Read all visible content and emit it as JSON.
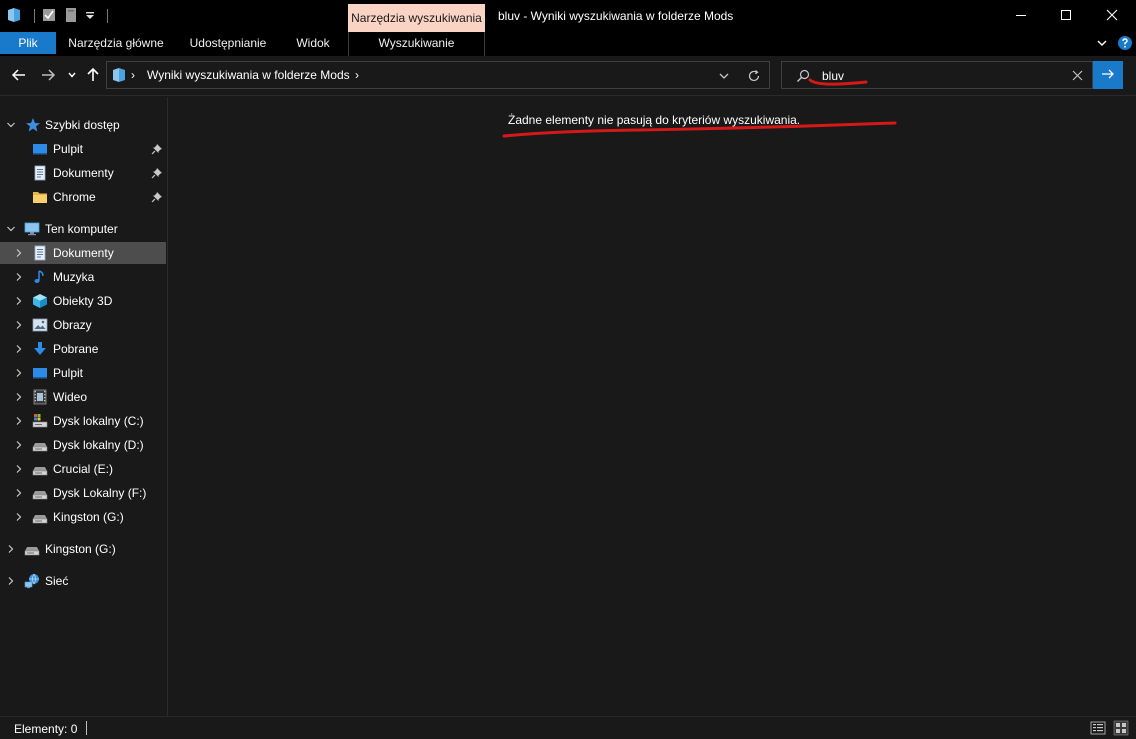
{
  "window": {
    "title": "bluv - Wyniki wyszukiwania w folderze Mods",
    "context_tab": "Narzędzia wyszukiwania"
  },
  "ribbon": {
    "tabs": [
      {
        "label": "Plik"
      },
      {
        "label": "Narzędzia główne"
      },
      {
        "label": "Udostępnianie"
      },
      {
        "label": "Widok"
      },
      {
        "label": "Wyszukiwanie"
      }
    ]
  },
  "address": {
    "path": "Wyniki wyszukiwania w folderze Mods",
    "separator": "›"
  },
  "search": {
    "value": "bluv"
  },
  "sidebar": {
    "quick_access": {
      "label": "Szybki dostęp",
      "items": [
        {
          "label": "Pulpit",
          "icon": "desktop-icon",
          "pinned": true
        },
        {
          "label": "Dokumenty",
          "icon": "documents-icon",
          "pinned": true
        },
        {
          "label": "Chrome",
          "icon": "folder-icon",
          "pinned": true
        }
      ]
    },
    "this_pc": {
      "label": "Ten komputer",
      "items": [
        {
          "label": "Dokumenty",
          "icon": "documents-icon",
          "selected": true
        },
        {
          "label": "Muzyka",
          "icon": "music-icon"
        },
        {
          "label": "Obiekty 3D",
          "icon": "cube-3d-icon"
        },
        {
          "label": "Obrazy",
          "icon": "pictures-icon"
        },
        {
          "label": "Pobrane",
          "icon": "download-icon"
        },
        {
          "label": "Pulpit",
          "icon": "desktop-icon"
        },
        {
          "label": "Wideo",
          "icon": "video-icon"
        },
        {
          "label": "Dysk lokalny (C:)",
          "icon": "system-drive-icon"
        },
        {
          "label": "Dysk lokalny (D:)",
          "icon": "drive-icon"
        },
        {
          "label": "Crucial (E:)",
          "icon": "drive-icon"
        },
        {
          "label": "Dysk Lokalny (F:)",
          "icon": "drive-icon"
        },
        {
          "label": "Kingston (G:)",
          "icon": "drive-icon"
        }
      ]
    },
    "extra": [
      {
        "label": "Kingston (G:)",
        "icon": "drive-icon"
      },
      {
        "label": "Sieć",
        "icon": "network-icon"
      }
    ]
  },
  "content": {
    "empty_message": "Żadne elementy nie pasują do kryteriów wyszukiwania."
  },
  "status": {
    "items_count": "Elementy: 0"
  },
  "colors": {
    "accent": "#1979ca",
    "context_tab": "#f9d3c4",
    "background": "#191919",
    "titlebar": "#000000",
    "selection": "#4d4d4d",
    "annotation": "#d51818"
  }
}
